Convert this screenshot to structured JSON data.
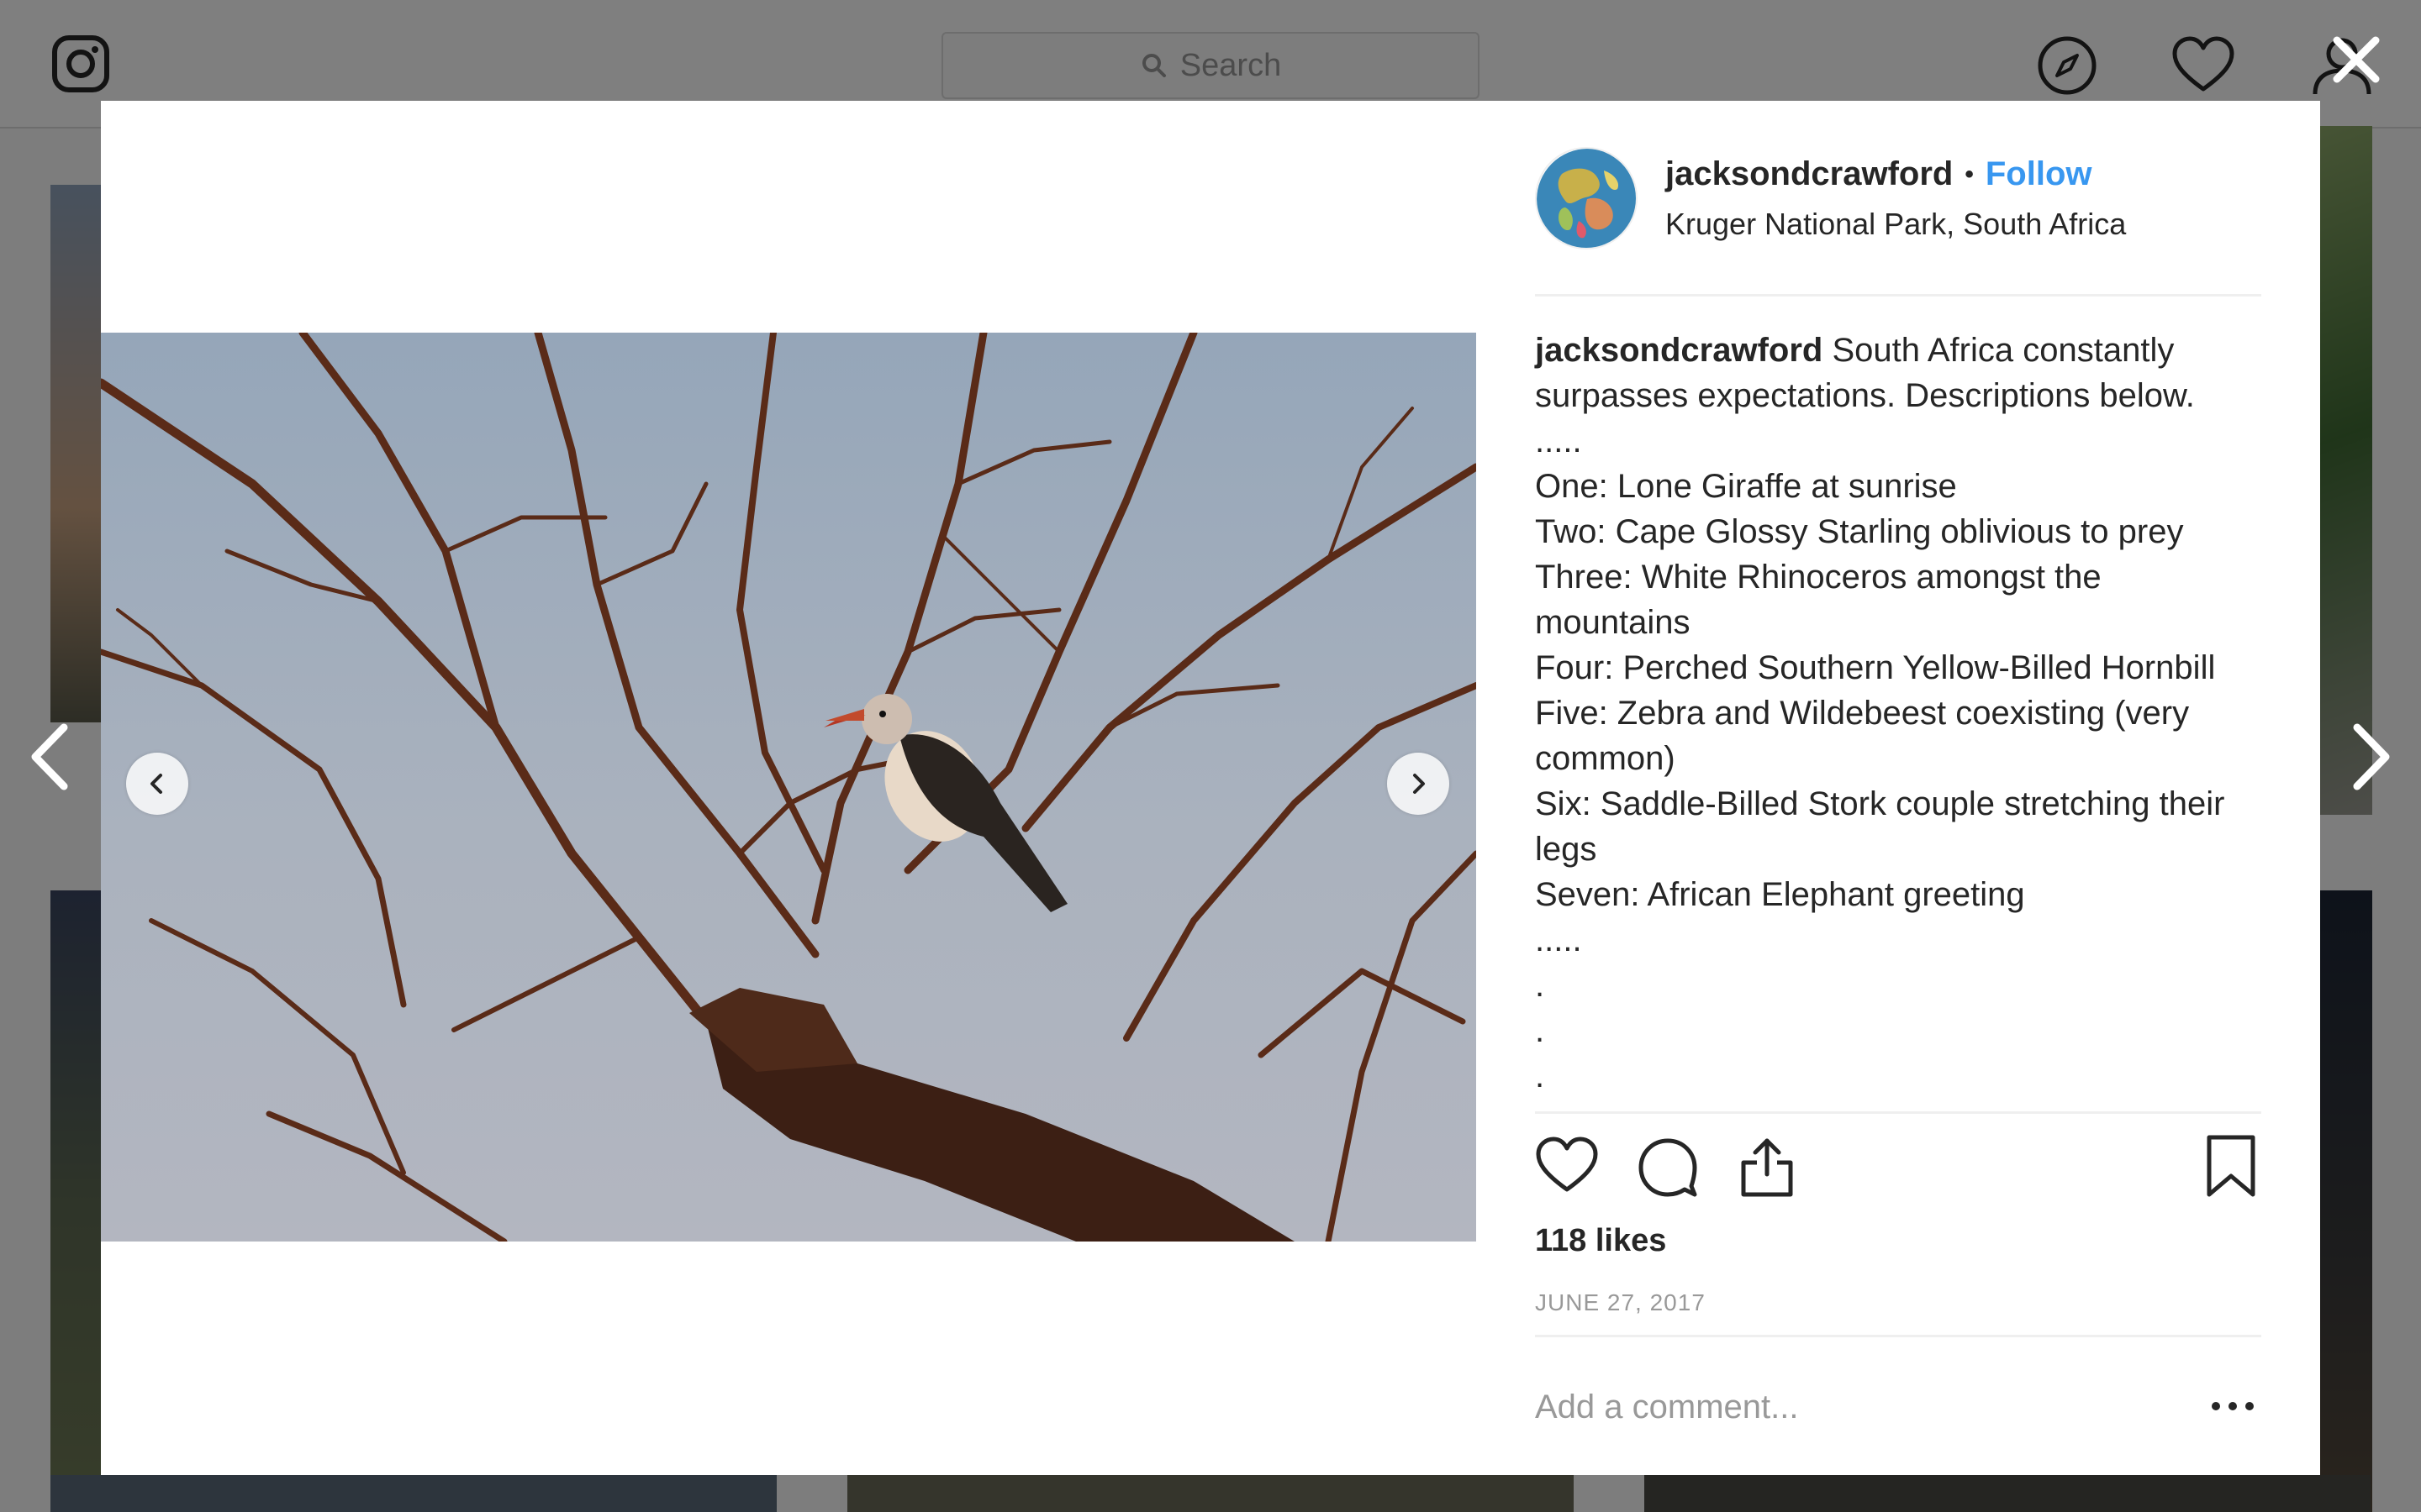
{
  "background": {
    "search_placeholder": "Search"
  },
  "post": {
    "username": "jacksondcrawford",
    "follow_label": "Follow",
    "separator": "•",
    "location": "Kruger National Park, South Africa",
    "caption_user": "jacksondcrawford",
    "caption_text": " South Africa constantly surpasses expectations. Descriptions below.\n.....\nOne: Lone Giraffe at sunrise\nTwo: Cape Glossy Starling oblivious to prey\nThree: White Rhinoceros amongst the mountains\nFour: Perched Southern Yellow-Billed Hornbill\nFive: Zebra and Wildebeest coexisting (very common)\nSix: Saddle-Billed Stork couple stretching their legs\nSeven: African Elephant greeting\n.....\n.\n.\n.",
    "likes": "118 likes",
    "date": "JUNE 27, 2017",
    "comment_placeholder": "Add a comment..."
  },
  "icons": {
    "instagram": "instagram-icon",
    "explore": "compass-icon",
    "activity": "heart-icon",
    "profile": "user-icon",
    "close": "close-icon",
    "like": "heart-icon",
    "comment": "comment-icon",
    "share": "share-icon",
    "save": "bookmark-icon",
    "more": "more-icon"
  },
  "colors": {
    "link_blue": "#3897f0",
    "text": "#262626",
    "muted": "#999999",
    "divider": "#efefef"
  }
}
